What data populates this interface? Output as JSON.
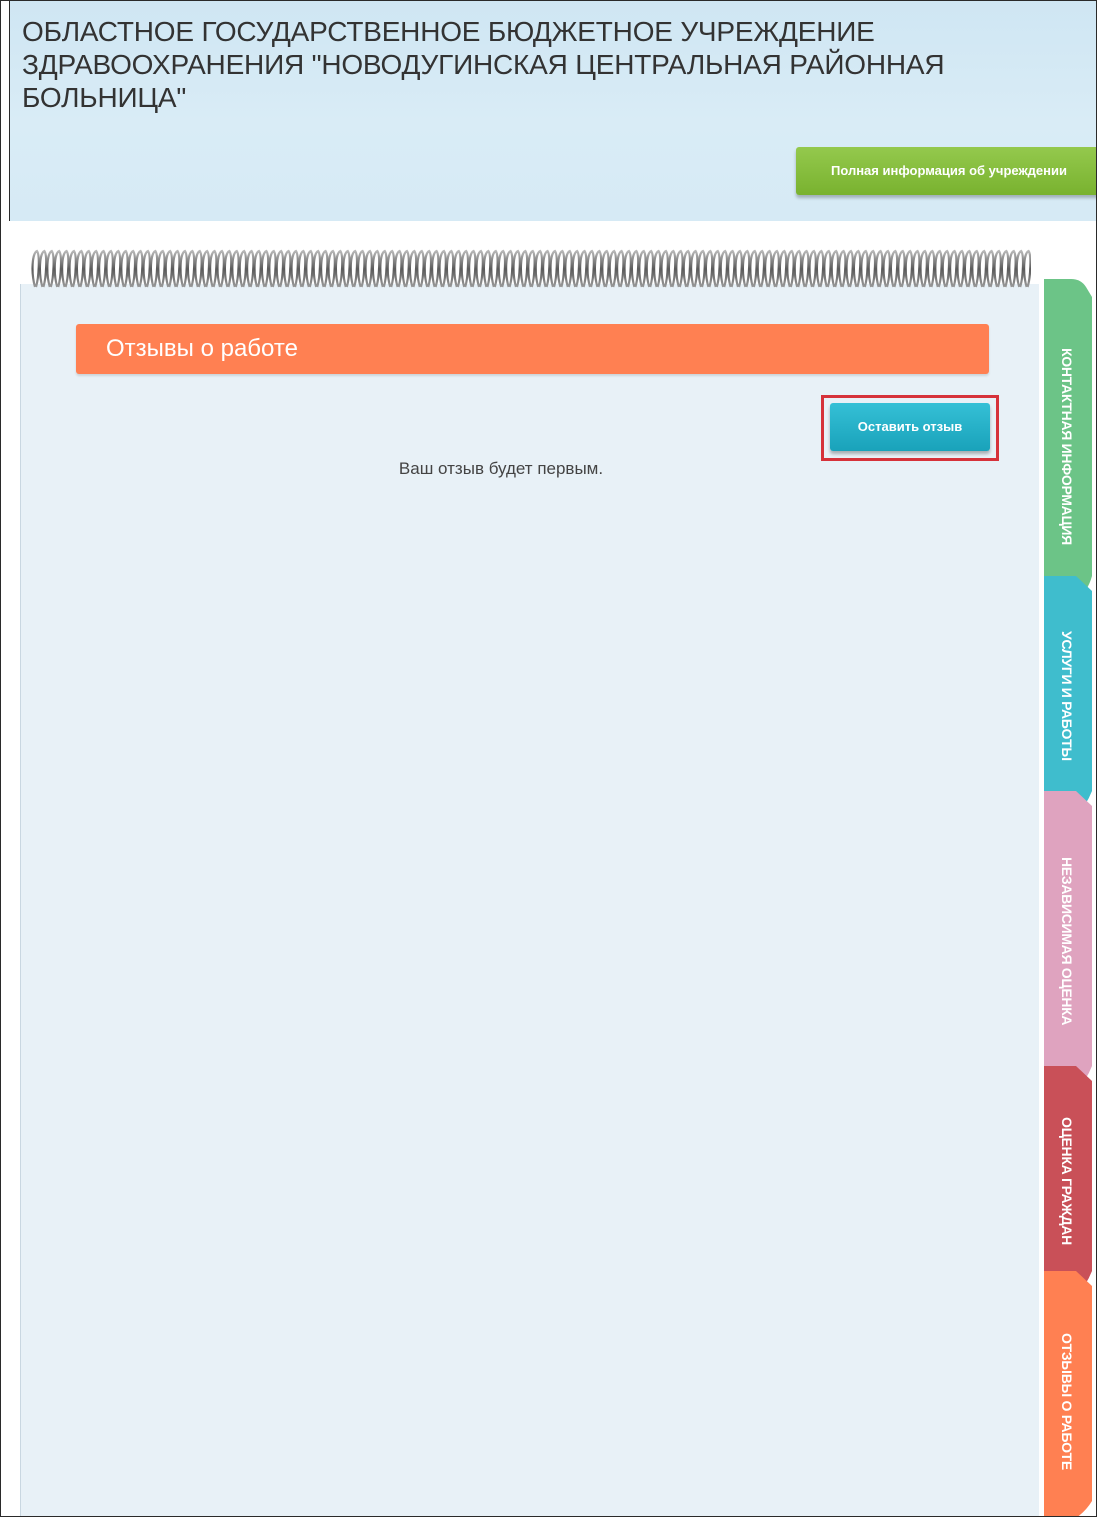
{
  "header": {
    "title": "ОБЛАСТНОЕ ГОСУДАРСТВЕННОЕ БЮДЖЕТНОЕ УЧРЕЖДЕНИЕ ЗДРАВООХРАНЕНИЯ \"НОВОДУГИНСКАЯ ЦЕНТРАЛЬНАЯ РАЙОННАЯ БОЛЬНИЦА\"",
    "info_button_label": "Полная информация об учреждении"
  },
  "main": {
    "section_title": "Отзывы о работе",
    "leave_review_label": "Оставить отзыв",
    "empty_message": "Ваш отзыв будет первым."
  },
  "tabs": [
    {
      "label": "КОНТАКТНАЯ ИНФОРМАЦИЯ",
      "color": "#6cc487"
    },
    {
      "label": "УСЛУГИ И РАБОТЫ",
      "color": "#3fbdcd"
    },
    {
      "label": "НЕЗАВИСИМАЯ ОЦЕНКА",
      "color": "#dfa3bf"
    },
    {
      "label": "ОЦЕНКА ГРАЖДАН",
      "color": "#c95058"
    },
    {
      "label": "ОТЗЫВЫ О РАБОТЕ",
      "color": "#ff8052"
    }
  ],
  "colors": {
    "header_bg": "#d6eaf5",
    "notebook_bg": "#e8f1f7",
    "section_header": "#ff8052",
    "info_button": "#79b22f",
    "review_button": "#19a2ba",
    "highlight": "#d6323a"
  }
}
